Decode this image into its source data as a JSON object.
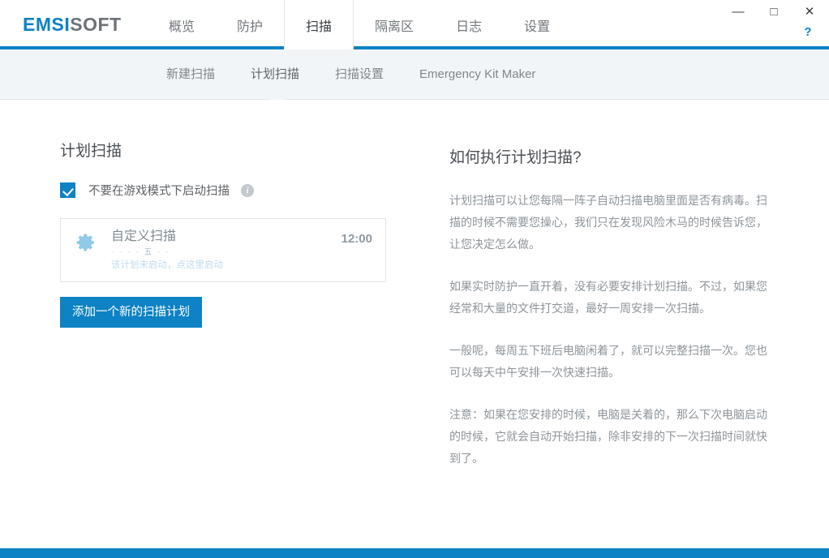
{
  "window": {
    "logo_em": "EMSI",
    "logo_soft": "SOFT",
    "minimize": "—",
    "maximize": "□",
    "close": "✕",
    "help": "?"
  },
  "mainnav": {
    "tabs": [
      {
        "label": "概览",
        "active": false
      },
      {
        "label": "防护",
        "active": false
      },
      {
        "label": "扫描",
        "active": true
      },
      {
        "label": "隔离区",
        "active": false
      },
      {
        "label": "日志",
        "active": false
      },
      {
        "label": "设置",
        "active": false
      }
    ]
  },
  "subnav": {
    "tabs": [
      {
        "label": "新建扫描",
        "active": false
      },
      {
        "label": "计划扫描",
        "active": true
      },
      {
        "label": "扫描设置",
        "active": false
      },
      {
        "label": "Emergency Kit Maker",
        "active": false
      }
    ]
  },
  "main": {
    "page_title": "计划扫描",
    "gamemode": {
      "label": "不要在游戏模式下启动扫描",
      "checked": true,
      "info_glyph": "i"
    },
    "schedules": [
      {
        "name": "自定义扫描",
        "days": "- - - - 五 - -",
        "days_parts": {
          "before": "- - - - ",
          "active_day": "五",
          "after": " - -"
        },
        "status": "该计划未启动，点这里启动",
        "time": "12:00"
      }
    ],
    "add_button": "添加一个新的扫描计划"
  },
  "help": {
    "title": "如何执行计划扫描?",
    "paragraphs": [
      "计划扫描可以让您每隔一阵子自动扫描电脑里面是否有病毒。扫描的时候不需要您操心，我们只在发现风险木马的时候告诉您，让您决定怎么做。",
      "如果实时防护一直开着，没有必要安排计划扫描。不过，如果您经常和大量的文件打交道，最好一周安排一次扫描。",
      "一般呢，每周五下班后电脑闲着了，就可以完整扫描一次。您也可以每天中午安排一次快速扫描。",
      "注意：如果在您安排的时候，电脑是关着的，那么下次电脑启动的时候，它就会自动开始扫描，除非安排的下一次扫描时间就快到了。"
    ]
  },
  "colors": {
    "brand_blue": "#0d82c4",
    "subnav_bg": "#f2f5f7",
    "border": "#e2e5e7",
    "text_muted": "#8d949a",
    "gear_blue": "#8fcae8",
    "status_link": "#bcdcef"
  }
}
